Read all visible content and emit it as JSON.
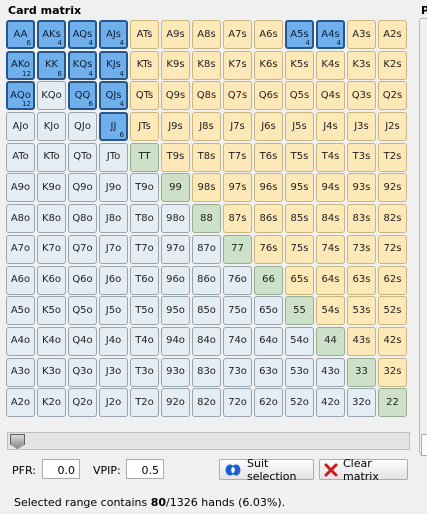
{
  "panel": {
    "title": "Card matrix",
    "right_title": "P"
  },
  "matrix": [
    [
      {
        "l": "AA",
        "s": "sel",
        "c": "6"
      },
      {
        "l": "AKs",
        "s": "sel",
        "c": "4"
      },
      {
        "l": "AQs",
        "s": "sel",
        "c": "4"
      },
      {
        "l": "AJs",
        "s": "sel",
        "c": "4"
      },
      {
        "l": "ATs",
        "s": "off-s"
      },
      {
        "l": "A9s",
        "s": "off-s"
      },
      {
        "l": "A8s",
        "s": "off-s"
      },
      {
        "l": "A7s",
        "s": "off-s"
      },
      {
        "l": "A6s",
        "s": "off-s"
      },
      {
        "l": "A5s",
        "s": "sel",
        "c": "4"
      },
      {
        "l": "A4s",
        "s": "sel",
        "c": "4"
      },
      {
        "l": "A3s",
        "s": "off-s"
      },
      {
        "l": "A2s",
        "s": "off-s"
      }
    ],
    [
      {
        "l": "AKo",
        "s": "sel",
        "c": "12"
      },
      {
        "l": "KK",
        "s": "sel",
        "c": "6"
      },
      {
        "l": "KQs",
        "s": "sel",
        "c": "4"
      },
      {
        "l": "KJs",
        "s": "sel",
        "c": "4"
      },
      {
        "l": "KTs",
        "s": "off-s"
      },
      {
        "l": "K9s",
        "s": "off-s"
      },
      {
        "l": "K8s",
        "s": "off-s"
      },
      {
        "l": "K7s",
        "s": "off-s"
      },
      {
        "l": "K6s",
        "s": "off-s"
      },
      {
        "l": "K5s",
        "s": "off-s"
      },
      {
        "l": "K4s",
        "s": "off-s"
      },
      {
        "l": "K3s",
        "s": "off-s"
      },
      {
        "l": "K2s",
        "s": "off-s"
      }
    ],
    [
      {
        "l": "AQo",
        "s": "sel",
        "c": "12"
      },
      {
        "l": "KQo",
        "s": "off-o"
      },
      {
        "l": "QQ",
        "s": "sel",
        "c": "6"
      },
      {
        "l": "QJs",
        "s": "sel",
        "c": "4"
      },
      {
        "l": "QTs",
        "s": "off-s"
      },
      {
        "l": "Q9s",
        "s": "off-s"
      },
      {
        "l": "Q8s",
        "s": "off-s"
      },
      {
        "l": "Q7s",
        "s": "off-s"
      },
      {
        "l": "Q6s",
        "s": "off-s"
      },
      {
        "l": "Q5s",
        "s": "off-s"
      },
      {
        "l": "Q4s",
        "s": "off-s"
      },
      {
        "l": "Q3s",
        "s": "off-s"
      },
      {
        "l": "Q2s",
        "s": "off-s"
      }
    ],
    [
      {
        "l": "AJo",
        "s": "off-o"
      },
      {
        "l": "KJo",
        "s": "off-o"
      },
      {
        "l": "QJo",
        "s": "off-o"
      },
      {
        "l": "JJ",
        "s": "sel",
        "c": "6"
      },
      {
        "l": "JTs",
        "s": "off-s"
      },
      {
        "l": "J9s",
        "s": "off-s"
      },
      {
        "l": "J8s",
        "s": "off-s"
      },
      {
        "l": "J7s",
        "s": "off-s"
      },
      {
        "l": "J6s",
        "s": "off-s"
      },
      {
        "l": "J5s",
        "s": "off-s"
      },
      {
        "l": "J4s",
        "s": "off-s"
      },
      {
        "l": "J3s",
        "s": "off-s"
      },
      {
        "l": "J2s",
        "s": "off-s"
      }
    ],
    [
      {
        "l": "ATo",
        "s": "off-o"
      },
      {
        "l": "KTo",
        "s": "off-o"
      },
      {
        "l": "QTo",
        "s": "off-o"
      },
      {
        "l": "JTo",
        "s": "off-o"
      },
      {
        "l": "TT",
        "s": "off-p"
      },
      {
        "l": "T9s",
        "s": "off-s"
      },
      {
        "l": "T8s",
        "s": "off-s"
      },
      {
        "l": "T7s",
        "s": "off-s"
      },
      {
        "l": "T6s",
        "s": "off-s"
      },
      {
        "l": "T5s",
        "s": "off-s"
      },
      {
        "l": "T4s",
        "s": "off-s"
      },
      {
        "l": "T3s",
        "s": "off-s"
      },
      {
        "l": "T2s",
        "s": "off-s"
      }
    ],
    [
      {
        "l": "A9o",
        "s": "off-o"
      },
      {
        "l": "K9o",
        "s": "off-o"
      },
      {
        "l": "Q9o",
        "s": "off-o"
      },
      {
        "l": "J9o",
        "s": "off-o"
      },
      {
        "l": "T9o",
        "s": "off-o"
      },
      {
        "l": "99",
        "s": "off-p"
      },
      {
        "l": "98s",
        "s": "off-s"
      },
      {
        "l": "97s",
        "s": "off-s"
      },
      {
        "l": "96s",
        "s": "off-s"
      },
      {
        "l": "95s",
        "s": "off-s"
      },
      {
        "l": "94s",
        "s": "off-s"
      },
      {
        "l": "93s",
        "s": "off-s"
      },
      {
        "l": "92s",
        "s": "off-s"
      }
    ],
    [
      {
        "l": "A8o",
        "s": "off-o"
      },
      {
        "l": "K8o",
        "s": "off-o"
      },
      {
        "l": "Q8o",
        "s": "off-o"
      },
      {
        "l": "J8o",
        "s": "off-o"
      },
      {
        "l": "T8o",
        "s": "off-o"
      },
      {
        "l": "98o",
        "s": "off-o"
      },
      {
        "l": "88",
        "s": "off-p"
      },
      {
        "l": "87s",
        "s": "off-s"
      },
      {
        "l": "86s",
        "s": "off-s"
      },
      {
        "l": "85s",
        "s": "off-s"
      },
      {
        "l": "84s",
        "s": "off-s"
      },
      {
        "l": "83s",
        "s": "off-s"
      },
      {
        "l": "82s",
        "s": "off-s"
      }
    ],
    [
      {
        "l": "A7o",
        "s": "off-o"
      },
      {
        "l": "K7o",
        "s": "off-o"
      },
      {
        "l": "Q7o",
        "s": "off-o"
      },
      {
        "l": "J7o",
        "s": "off-o"
      },
      {
        "l": "T7o",
        "s": "off-o"
      },
      {
        "l": "97o",
        "s": "off-o"
      },
      {
        "l": "87o",
        "s": "off-o"
      },
      {
        "l": "77",
        "s": "off-p"
      },
      {
        "l": "76s",
        "s": "off-s"
      },
      {
        "l": "75s",
        "s": "off-s"
      },
      {
        "l": "74s",
        "s": "off-s"
      },
      {
        "l": "73s",
        "s": "off-s"
      },
      {
        "l": "72s",
        "s": "off-s"
      }
    ],
    [
      {
        "l": "A6o",
        "s": "off-o"
      },
      {
        "l": "K6o",
        "s": "off-o"
      },
      {
        "l": "Q6o",
        "s": "off-o"
      },
      {
        "l": "J6o",
        "s": "off-o"
      },
      {
        "l": "T6o",
        "s": "off-o"
      },
      {
        "l": "96o",
        "s": "off-o"
      },
      {
        "l": "86o",
        "s": "off-o"
      },
      {
        "l": "76o",
        "s": "off-o"
      },
      {
        "l": "66",
        "s": "off-p"
      },
      {
        "l": "65s",
        "s": "off-s"
      },
      {
        "l": "64s",
        "s": "off-s"
      },
      {
        "l": "63s",
        "s": "off-s"
      },
      {
        "l": "62s",
        "s": "off-s"
      }
    ],
    [
      {
        "l": "A5o",
        "s": "off-o"
      },
      {
        "l": "K5o",
        "s": "off-o"
      },
      {
        "l": "Q5o",
        "s": "off-o"
      },
      {
        "l": "J5o",
        "s": "off-o"
      },
      {
        "l": "T5o",
        "s": "off-o"
      },
      {
        "l": "95o",
        "s": "off-o"
      },
      {
        "l": "85o",
        "s": "off-o"
      },
      {
        "l": "75o",
        "s": "off-o"
      },
      {
        "l": "65o",
        "s": "off-o"
      },
      {
        "l": "55",
        "s": "off-p"
      },
      {
        "l": "54s",
        "s": "off-s"
      },
      {
        "l": "53s",
        "s": "off-s"
      },
      {
        "l": "52s",
        "s": "off-s"
      }
    ],
    [
      {
        "l": "A4o",
        "s": "off-o"
      },
      {
        "l": "K4o",
        "s": "off-o"
      },
      {
        "l": "Q4o",
        "s": "off-o"
      },
      {
        "l": "J4o",
        "s": "off-o"
      },
      {
        "l": "T4o",
        "s": "off-o"
      },
      {
        "l": "94o",
        "s": "off-o"
      },
      {
        "l": "84o",
        "s": "off-o"
      },
      {
        "l": "74o",
        "s": "off-o"
      },
      {
        "l": "64o",
        "s": "off-o"
      },
      {
        "l": "54o",
        "s": "off-o"
      },
      {
        "l": "44",
        "s": "off-p"
      },
      {
        "l": "43s",
        "s": "off-s"
      },
      {
        "l": "42s",
        "s": "off-s"
      }
    ],
    [
      {
        "l": "A3o",
        "s": "off-o"
      },
      {
        "l": "K3o",
        "s": "off-o"
      },
      {
        "l": "Q3o",
        "s": "off-o"
      },
      {
        "l": "J3o",
        "s": "off-o"
      },
      {
        "l": "T3o",
        "s": "off-o"
      },
      {
        "l": "93o",
        "s": "off-o"
      },
      {
        "l": "83o",
        "s": "off-o"
      },
      {
        "l": "73o",
        "s": "off-o"
      },
      {
        "l": "63o",
        "s": "off-o"
      },
      {
        "l": "53o",
        "s": "off-o"
      },
      {
        "l": "43o",
        "s": "off-o"
      },
      {
        "l": "33",
        "s": "off-p"
      },
      {
        "l": "32s",
        "s": "off-s"
      }
    ],
    [
      {
        "l": "A2o",
        "s": "off-o"
      },
      {
        "l": "K2o",
        "s": "off-o"
      },
      {
        "l": "Q2o",
        "s": "off-o"
      },
      {
        "l": "J2o",
        "s": "off-o"
      },
      {
        "l": "T2o",
        "s": "off-o"
      },
      {
        "l": "92o",
        "s": "off-o"
      },
      {
        "l": "82o",
        "s": "off-o"
      },
      {
        "l": "72o",
        "s": "off-o"
      },
      {
        "l": "62o",
        "s": "off-o"
      },
      {
        "l": "52o",
        "s": "off-o"
      },
      {
        "l": "42o",
        "s": "off-o"
      },
      {
        "l": "32o",
        "s": "off-o"
      },
      {
        "l": "22",
        "s": "off-p"
      }
    ]
  ],
  "slider": {
    "value": 0
  },
  "controls": {
    "pfr_label": "PFR:",
    "pfr_value": "0.0",
    "vpip_label": "VPIP:",
    "vpip_value": "0.5",
    "suit_selection_label": "Suit selection",
    "clear_matrix_label": "Clear matrix"
  },
  "status": {
    "prefix": "Selected range contains ",
    "selected": "80",
    "suffix": "/1326 hands (6.03%)."
  },
  "colors": {
    "selected": "#6fb0ec",
    "suited": "#fde8b8",
    "offsuit": "#e5edf4",
    "pair": "#cde0c8"
  }
}
